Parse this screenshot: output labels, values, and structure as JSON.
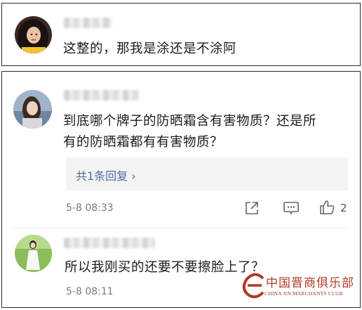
{
  "comments": [
    {
      "username": "",
      "avatar": "woman-dark-hair-avatar",
      "text": "这整的，那我是涂还是不涂阿"
    },
    {
      "username": "",
      "avatar": "woman-seaside-avatar",
      "text_line1": "到底哪个牌子的防晒霜含有害物质？还是所",
      "text_line2": "有的防晒霜都有有害物质？",
      "replies_label": "共1条回复 ›",
      "time": "5-8 08:33",
      "like_count": "2"
    },
    {
      "username": "",
      "avatar": "woman-white-dress-avatar",
      "text": "所以我刚买的还要不要擦脸上了？",
      "time": "5-8 08:11"
    }
  ],
  "watermark": {
    "chinese": "中国晋商俱乐部",
    "english": "CHINA JIN MARCHANTS CLUB"
  },
  "colors": {
    "reply_link": "#4a6fa0",
    "watermark": "#b03a28"
  }
}
